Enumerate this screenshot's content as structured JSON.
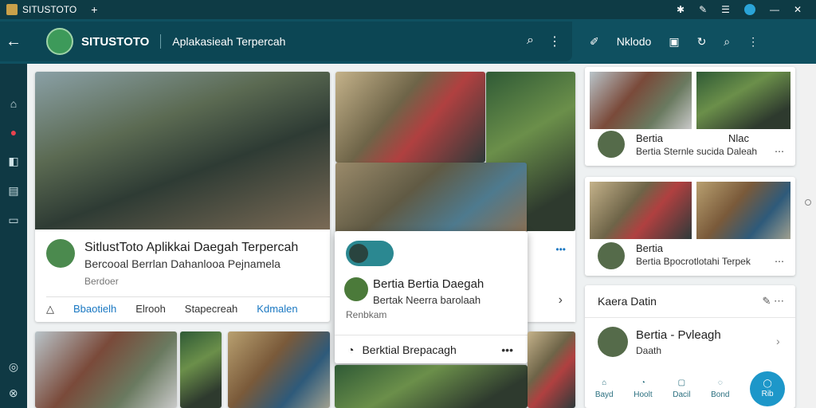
{
  "window": {
    "title": "SITUSTOTO",
    "new_tab": "+",
    "controls": [
      "✱",
      "✎",
      "☰",
      "●",
      "—",
      "✕"
    ]
  },
  "appbar": {
    "back": "←",
    "title": "SITUSTOTO",
    "subtitle": "Aplakasieah Terpercah",
    "search": "⌕",
    "more": "⋮",
    "tools": [
      "✐",
      "Nklodo",
      "▣",
      "↻",
      "⌕",
      "⋮"
    ]
  },
  "sidenav": {
    "items": [
      "⌂",
      "●",
      "◧",
      "▤",
      "▭"
    ],
    "bottom": [
      "◎",
      "⊗"
    ]
  },
  "main_card": {
    "title": "SitlustToto Aplikkai Daegah Terpercah",
    "subtitle": "Bercooal Berrlan Dahanlooa Pejnamela",
    "meta": "Berdoer",
    "actions": [
      "Bbaotielh",
      "Elrooh",
      "Stapecreah",
      "Kdmalen"
    ],
    "action_icons": [
      "△",
      "✐",
      "▣"
    ]
  },
  "popup": {
    "title": "Bertia Bertia Daegah",
    "subtitle": "Bertak Neerra barolaah",
    "meta": "Renbkam",
    "footer": "Berktial Brepacagh",
    "footer_icon": "◔",
    "more": "•••"
  },
  "mid_side": {
    "dots": "•••",
    "chevron": "›"
  },
  "right_cards": [
    {
      "title": "Bertia",
      "extra": "Nlac",
      "sub": "Bertia Sternle sucida Daleah",
      "more": "⋯"
    },
    {
      "title": "Bertia",
      "sub": "Bertia Bpocrotlotahi Terpek",
      "more": "⋯"
    }
  ],
  "right_panel": {
    "header": "Kaera Datin",
    "header_icons": "✎ ⋯",
    "item_title": "Bertia - Pvleagh",
    "item_sub": "Daath",
    "tabs": [
      {
        "icon": "⌂",
        "label": "Bayd"
      },
      {
        "icon": "◔",
        "label": "Hoolt"
      },
      {
        "icon": "▢",
        "label": "Dacil"
      },
      {
        "icon": "◌",
        "label": "Bond"
      }
    ],
    "fab": {
      "icon": "◯",
      "label": "Rib"
    }
  }
}
